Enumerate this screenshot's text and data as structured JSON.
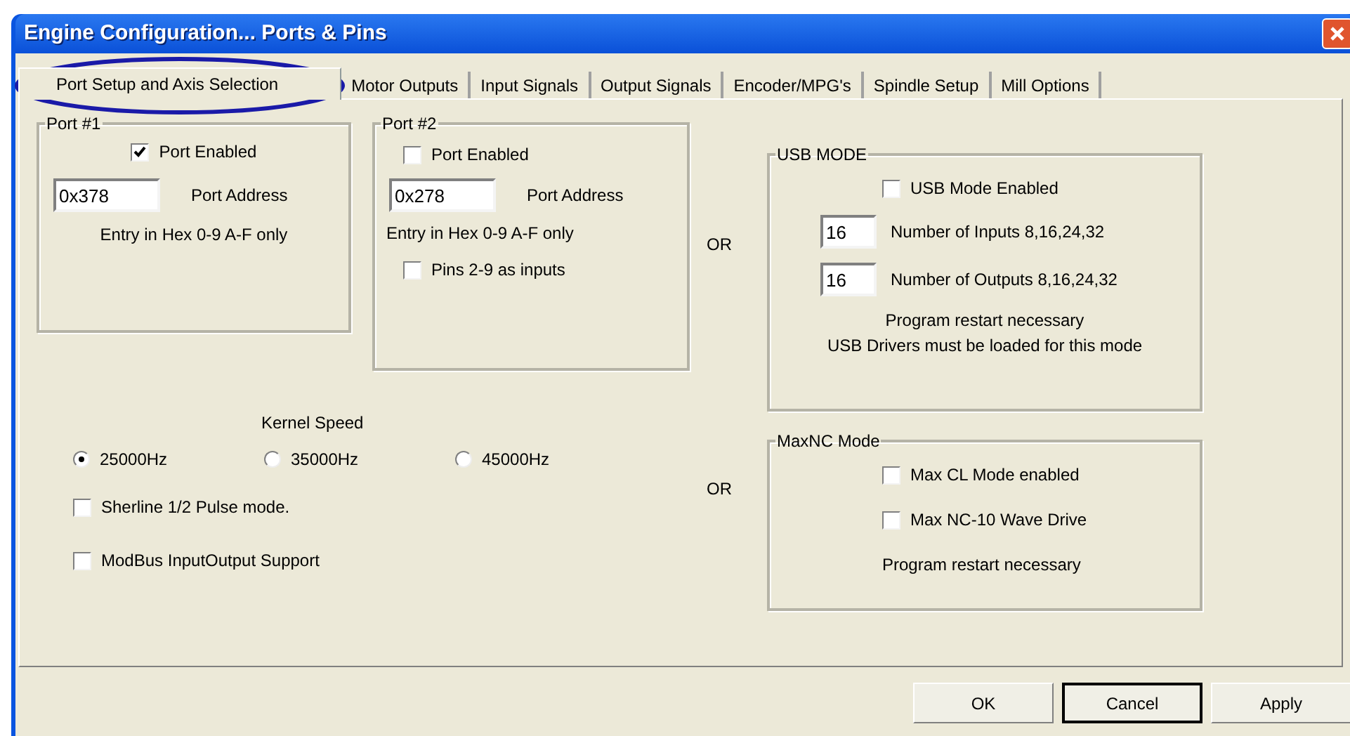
{
  "window": {
    "title": "Engine Configuration... Ports & Pins"
  },
  "tabs": [
    {
      "label": "Port Setup and Axis Selection",
      "selected": true
    },
    {
      "label": "Motor Outputs",
      "selected": false
    },
    {
      "label": "Input Signals",
      "selected": false
    },
    {
      "label": "Output Signals",
      "selected": false
    },
    {
      "label": "Encoder/MPG's",
      "selected": false
    },
    {
      "label": "Spindle Setup",
      "selected": false
    },
    {
      "label": "Mill Options",
      "selected": false
    }
  ],
  "port1": {
    "title": "Port #1",
    "enabled": {
      "label": "Port Enabled",
      "checked": true
    },
    "address": {
      "value": "0x378",
      "label": "Port Address"
    },
    "hint": "Entry in Hex 0-9 A-F only"
  },
  "port2": {
    "title": "Port #2",
    "enabled": {
      "label": "Port Enabled",
      "checked": false
    },
    "address": {
      "value": "0x278",
      "label": "Port Address"
    },
    "hint": "Entry in Hex 0-9 A-F only",
    "pins_as_inputs": {
      "label": "Pins 2-9 as inputs",
      "checked": false
    }
  },
  "or_labels": [
    "OR",
    "OR"
  ],
  "usb_mode": {
    "title": "USB MODE",
    "enabled": {
      "label": "USB Mode Enabled",
      "checked": false
    },
    "inputs": {
      "value": "16",
      "label": "Number of Inputs 8,16,24,32"
    },
    "outputs": {
      "value": "16",
      "label": "Number of Outputs 8,16,24,32"
    },
    "notes": [
      "Program restart necessary",
      "USB Drivers must be loaded for this mode"
    ]
  },
  "kernel_speed": {
    "label": "Kernel Speed",
    "options": [
      {
        "label": "25000Hz",
        "selected": true
      },
      {
        "label": "35000Hz",
        "selected": false
      },
      {
        "label": "45000Hz",
        "selected": false
      }
    ]
  },
  "options": [
    {
      "label": "Sherline 1/2 Pulse mode.",
      "checked": false
    },
    {
      "label": "ModBus InputOutput Support",
      "checked": false
    }
  ],
  "maxnc_mode": {
    "title": "MaxNC Mode",
    "options": [
      {
        "label": "Max CL Mode enabled",
        "checked": false
      },
      {
        "label": "Max NC-10 Wave Drive",
        "checked": false
      }
    ],
    "note": "Program restart necessary"
  },
  "buttons": [
    {
      "label": "OK",
      "focused": false
    },
    {
      "label": "Cancel",
      "focused": true
    },
    {
      "label": "Apply",
      "focused": false
    }
  ]
}
